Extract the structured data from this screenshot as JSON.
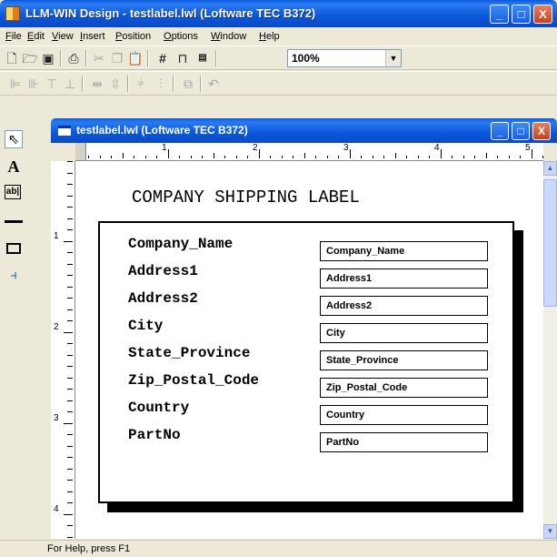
{
  "app": {
    "title": "LLM-WIN Design - testlabel.lwl (Loftware TEC B372)",
    "buttons": {
      "minimize": "_",
      "maximize": "□",
      "close": "X"
    }
  },
  "menu": [
    "File",
    "Edit",
    "View",
    "Insert",
    "Position",
    "Options",
    "Window",
    "Help"
  ],
  "toolbar": {
    "icons": [
      "new-file-icon",
      "open-folder-icon",
      "save-icon",
      "print-icon",
      "cut-icon",
      "copy-icon",
      "paste-icon",
      "grid-icon",
      "magnet-icon",
      "odbc-icon"
    ],
    "zoom": "100%"
  },
  "align_toolbar": {
    "icons": [
      "align-left-icon",
      "align-right-icon",
      "align-top-icon",
      "align-bottom-icon",
      "space-horizontal-icon",
      "space-vertical-icon",
      "center-horizontal-icon",
      "center-vertical-icon",
      "bring-front-icon",
      "undo-icon"
    ]
  },
  "palette": [
    "pointer-icon",
    "text-tool-icon",
    "field-tool-icon",
    "line-tool-icon",
    "rectangle-tool-icon",
    "barcode-tool-icon"
  ],
  "document": {
    "title": "testlabel.lwl (Loftware TEC B372)",
    "ruler_h": [
      "1",
      "2",
      "3",
      "4",
      "5"
    ],
    "ruler_v": [
      "1",
      "2",
      "3",
      "4"
    ]
  },
  "label": {
    "heading": "COMPANY SHIPPING LABEL",
    "fields": [
      {
        "name": "Company_Name",
        "value": "Company_Name"
      },
      {
        "name": "Address1",
        "value": "Address1"
      },
      {
        "name": "Address2",
        "value": "Address2"
      },
      {
        "name": "City",
        "value": "City"
      },
      {
        "name": "State_Province",
        "value": "State_Province"
      },
      {
        "name": "Zip_Postal_Code",
        "value": "Zip_Postal_Code"
      },
      {
        "name": "Country",
        "value": "Country"
      },
      {
        "name": "PartNo",
        "value": "PartNo"
      }
    ]
  },
  "status": "For Help, press F1"
}
